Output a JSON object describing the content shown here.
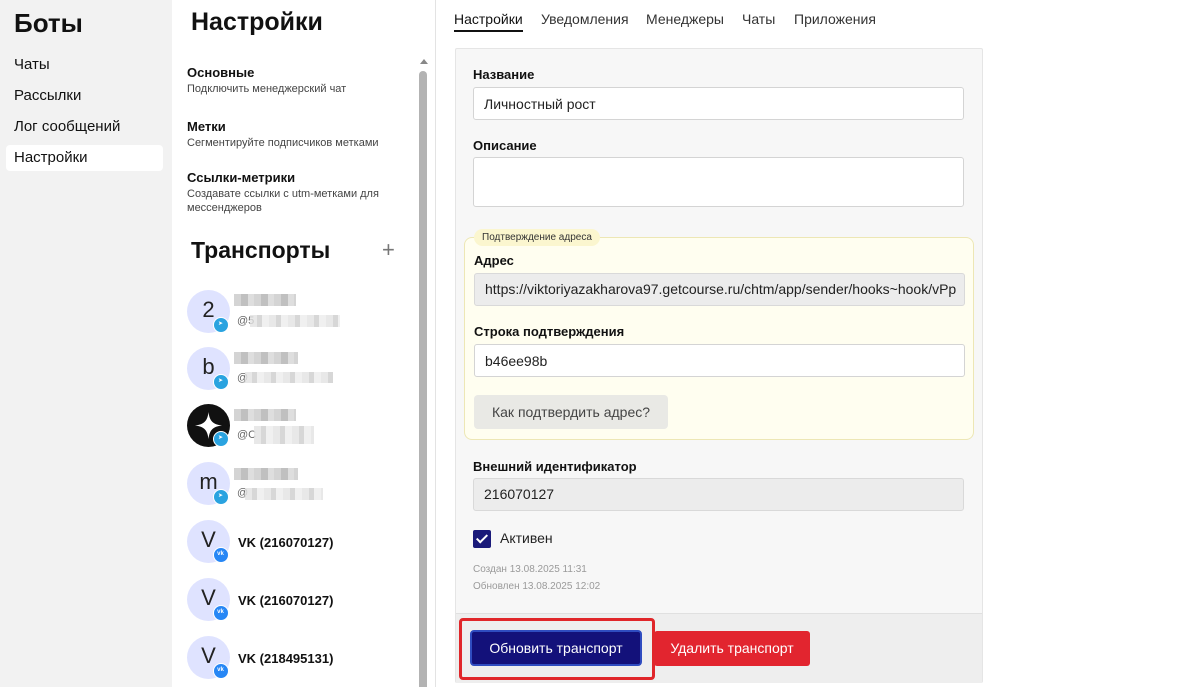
{
  "nav": {
    "title": "Боты",
    "items": [
      {
        "label": "Чаты"
      },
      {
        "label": "Рассылки"
      },
      {
        "label": "Лог сообщений"
      },
      {
        "label": "Настройки"
      }
    ]
  },
  "settings": {
    "title": "Настройки",
    "menu": [
      {
        "title": "Основные",
        "subtitle": "Подключить менеджерский чат"
      },
      {
        "title": "Метки",
        "subtitle": "Сегментируйте подписчиков метками"
      },
      {
        "title": "Ссылки-метрики",
        "subtitle": "Создавате ссылки с utm-метками для мессенджеров"
      }
    ]
  },
  "transports": {
    "title": "Транспорты",
    "add_icon": "plus-icon",
    "items": [
      {
        "initial": "2",
        "type": "telegram",
        "handle": "@5"
      },
      {
        "initial": "b",
        "type": "telegram",
        "handle": "@"
      },
      {
        "initial": "",
        "type": "telegram",
        "handle": "@C"
      },
      {
        "initial": "m",
        "type": "telegram",
        "handle": "@"
      },
      {
        "initial": "V",
        "type": "vk",
        "name": "VK (216070127)"
      },
      {
        "initial": "V",
        "type": "vk",
        "name": "VK (216070127)"
      },
      {
        "initial": "V",
        "type": "vk",
        "name": "VK (218495131)"
      }
    ]
  },
  "tabs": [
    {
      "label": "Настройки"
    },
    {
      "label": "Уведомления"
    },
    {
      "label": "Менеджеры"
    },
    {
      "label": "Чаты"
    },
    {
      "label": "Приложения"
    }
  ],
  "form": {
    "name_label": "Название",
    "name_value": "Личностный рост",
    "description_label": "Описание",
    "description_value": "",
    "verification": {
      "tag": "Подтверждение адреса",
      "address_label": "Адрес",
      "address_value": "https://viktoriyazakharova97.getcourse.ru/chtm/app/sender/hooks~hook/vPp",
      "confirm_label": "Строка подтверждения",
      "confirm_value": "b46ee98b",
      "help_button": "Как подтвердить адрес?"
    },
    "external_id_label": "Внешний идентификатор",
    "external_id_value": "216070127",
    "active_label": "Активен",
    "active_checked": true,
    "created": "Создан 13.08.2025 11:31",
    "updated": "Обновлен 13.08.2025 12:02",
    "update_button": "Обновить транспорт",
    "delete_button": "Удалить транспорт"
  }
}
